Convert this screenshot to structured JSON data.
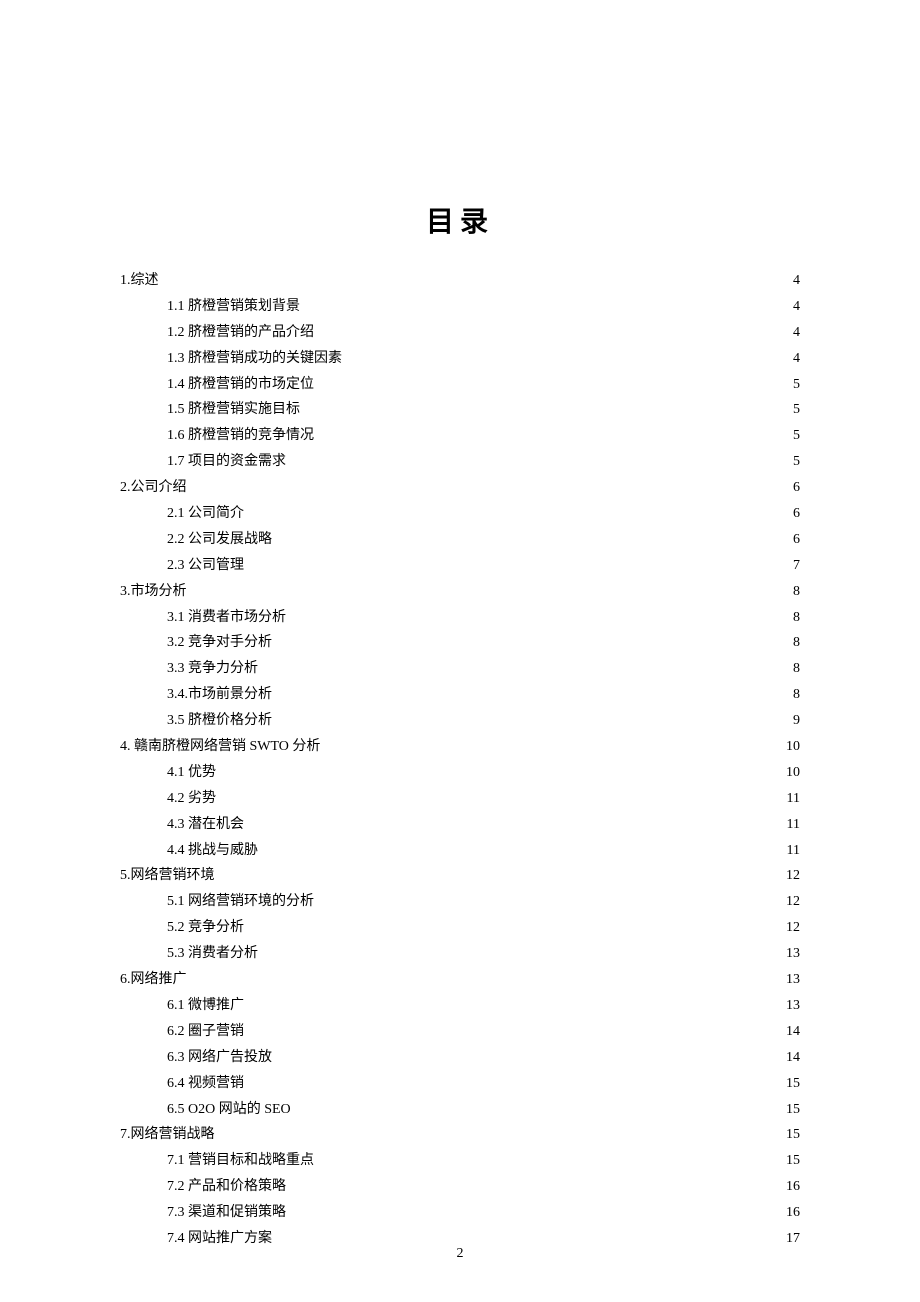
{
  "title": "目录",
  "page_number": "2",
  "toc": [
    {
      "level": 1,
      "label": "1.综述",
      "page": "4"
    },
    {
      "level": 2,
      "label": "1.1 脐橙营销策划背景",
      "page": "4"
    },
    {
      "level": 2,
      "label": "1.2 脐橙营销的产品介绍",
      "page": "4"
    },
    {
      "level": 2,
      "label": "1.3 脐橙营销成功的关键因素",
      "page": "4"
    },
    {
      "level": 2,
      "label": "1.4 脐橙营销的市场定位",
      "page": "5"
    },
    {
      "level": 2,
      "label": "1.5 脐橙营销实施目标",
      "page": "5"
    },
    {
      "level": 2,
      "label": "1.6 脐橙营销的竞争情况",
      "page": "5"
    },
    {
      "level": 2,
      "label": "1.7 项目的资金需求",
      "page": "5"
    },
    {
      "level": 1,
      "label": "2.公司介绍",
      "page": "6"
    },
    {
      "level": 2,
      "label": "2.1 公司简介",
      "page": "6"
    },
    {
      "level": 2,
      "label": "2.2 公司发展战略",
      "page": "6"
    },
    {
      "level": 2,
      "label": "2.3 公司管理",
      "page": "7"
    },
    {
      "level": 1,
      "label": "3.市场分析",
      "page": "8"
    },
    {
      "level": 2,
      "label": "3.1 消费者市场分析 ",
      "page": "8"
    },
    {
      "level": 2,
      "label": "3.2 竞争对手分析 ",
      "page": "8"
    },
    {
      "level": 2,
      "label": "3.3 竞争力分析",
      "page": "8"
    },
    {
      "level": 2,
      "label": "3.4.市场前景分析",
      "page": "8"
    },
    {
      "level": 2,
      "label": "3.5 脐橙价格分析",
      "page": "9"
    },
    {
      "level": 1,
      "label": "4. 赣南脐橙网络营销 SWTO 分析 ",
      "page": "10"
    },
    {
      "level": 2,
      "label": "4.1 优势   ",
      "page": "10"
    },
    {
      "level": 2,
      "label": "4.2 劣势 ",
      "page": "11"
    },
    {
      "level": 2,
      "label": "4.3 潜在机会 ",
      "page": "11"
    },
    {
      "level": 2,
      "label": "4.4 挑战与威胁 ",
      "page": "11"
    },
    {
      "level": 1,
      "label": "5.网络营销环境",
      "page": "12"
    },
    {
      "level": 2,
      "label": "5.1 网络营销环境的分析 ",
      "page": "12"
    },
    {
      "level": 2,
      "label": "5.2 竞争分析 ",
      "page": "12"
    },
    {
      "level": 2,
      "label": "5.3 消费者分析 ",
      "page": "13"
    },
    {
      "level": 1,
      "label": "6.网络推广",
      "page": "13"
    },
    {
      "level": 2,
      "label": "6.1 微博推广 ",
      "page": "13"
    },
    {
      "level": 2,
      "label": "6.2 圈子营销 ",
      "page": "14"
    },
    {
      "level": 2,
      "label": "6.3 网络广告投放 ",
      "page": "14"
    },
    {
      "level": 2,
      "label": "6.4 视频营销 ",
      "page": "15"
    },
    {
      "level": 2,
      "label": "6.5 O2O 网站的 SEO ",
      "page": "15"
    },
    {
      "level": 1,
      "label": "7.网络营销战略",
      "page": "15"
    },
    {
      "level": 2,
      "label": "7.1 营销目标和战略重点 ",
      "page": "15"
    },
    {
      "level": 2,
      "label": "7.2 产品和价格策略 ",
      "page": "16"
    },
    {
      "level": 2,
      "label": "7.3 渠道和促销策略 ",
      "page": "16"
    },
    {
      "level": 2,
      "label": "7.4 网站推广方案 ",
      "page": "17"
    }
  ]
}
